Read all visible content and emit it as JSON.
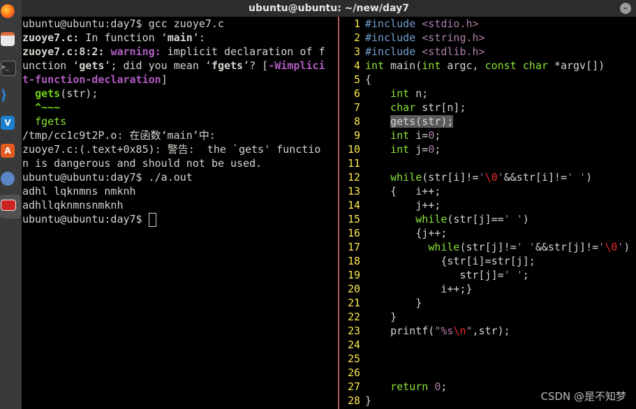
{
  "window": {
    "title": "ubuntu@ubuntu: ~/new/day7"
  },
  "dock": {
    "icons": [
      "firefox-icon",
      "files-icon",
      "terminal-icon",
      "vscode-icon",
      "vlc-icon",
      "software-center-icon",
      "network-icon",
      "active-app-icon"
    ]
  },
  "terminal": {
    "lines": [
      [
        {
          "t": "ubuntu@ubuntu:day7$ gcc zuoye7.c",
          "c": ""
        }
      ],
      [
        {
          "t": "zuoye7.c:",
          "c": "b"
        },
        {
          "t": " In function ‘",
          "c": ""
        },
        {
          "t": "main",
          "c": "b"
        },
        {
          "t": "’:",
          "c": ""
        }
      ],
      [
        {
          "t": "zuoye7.c:8:2: ",
          "c": "b"
        },
        {
          "t": "warning: ",
          "c": "mag"
        },
        {
          "t": "implicit declaration of f",
          "c": ""
        }
      ],
      [
        {
          "t": "unction ‘",
          "c": ""
        },
        {
          "t": "gets",
          "c": "b"
        },
        {
          "t": "’; did you mean ‘",
          "c": ""
        },
        {
          "t": "fgets",
          "c": "b"
        },
        {
          "t": "’? [",
          "c": ""
        },
        {
          "t": "-Wimplici",
          "c": "mag"
        }
      ],
      [
        {
          "t": "t-function-declaration",
          "c": "mag"
        },
        {
          "t": "]",
          "c": ""
        }
      ],
      [
        {
          "t": "  ",
          "c": ""
        },
        {
          "t": "gets",
          "c": "grn2"
        },
        {
          "t": "(str);",
          "c": ""
        }
      ],
      [
        {
          "t": "  ",
          "c": ""
        },
        {
          "t": "^~~~",
          "c": "grn2"
        }
      ],
      [
        {
          "t": "  ",
          "c": ""
        },
        {
          "t": "fgets",
          "c": "grn"
        }
      ],
      [
        {
          "t": "/tmp/cc1c9t2P.o: 在函数‘main’中:",
          "c": ""
        }
      ],
      [
        {
          "t": "zuoye7.c:(.text+0x85): 警告:  the `gets' functio",
          "c": ""
        }
      ],
      [
        {
          "t": "n is dangerous and should not be used.",
          "c": ""
        }
      ],
      [
        {
          "t": "ubuntu@ubuntu:day7$ ./a.out",
          "c": ""
        }
      ],
      [
        {
          "t": "adhl lqknmns nmknh",
          "c": ""
        }
      ],
      [
        {
          "t": "adhllqknmnsnmknh",
          "c": ""
        }
      ],
      [
        {
          "t": "ubuntu@ubuntu:day7$ ",
          "c": ""
        }
      ]
    ]
  },
  "editor": {
    "lines": [
      {
        "n": "1",
        "s": [
          {
            "t": "#include ",
            "c": "pp"
          },
          {
            "t": "<stdio.h>",
            "c": "str"
          }
        ]
      },
      {
        "n": "2",
        "s": [
          {
            "t": "#include ",
            "c": "pp"
          },
          {
            "t": "<string.h>",
            "c": "str"
          }
        ]
      },
      {
        "n": "3",
        "s": [
          {
            "t": "#include ",
            "c": "pp"
          },
          {
            "t": "<stdlib.h>",
            "c": "str"
          }
        ]
      },
      {
        "n": "4",
        "s": [
          {
            "t": "int",
            "c": "kw"
          },
          {
            "t": " main(",
            "c": ""
          },
          {
            "t": "int",
            "c": "kw"
          },
          {
            "t": " argc, ",
            "c": ""
          },
          {
            "t": "const",
            "c": "kw"
          },
          {
            "t": " ",
            "c": ""
          },
          {
            "t": "char",
            "c": "kw"
          },
          {
            "t": " *argv[])",
            "c": ""
          }
        ]
      },
      {
        "n": "5",
        "s": [
          {
            "t": "{",
            "c": ""
          }
        ]
      },
      {
        "n": "6",
        "s": [
          {
            "t": "    ",
            "c": ""
          },
          {
            "t": "int",
            "c": "kw"
          },
          {
            "t": " n;",
            "c": ""
          }
        ]
      },
      {
        "n": "7",
        "s": [
          {
            "t": "    ",
            "c": ""
          },
          {
            "t": "char",
            "c": "kw"
          },
          {
            "t": " str[n];",
            "c": ""
          }
        ]
      },
      {
        "n": "8",
        "s": [
          {
            "t": "    ",
            "c": ""
          },
          {
            "t": "gets(str);",
            "c": "hl"
          }
        ]
      },
      {
        "n": "9",
        "s": [
          {
            "t": "    ",
            "c": ""
          },
          {
            "t": "int",
            "c": "kw"
          },
          {
            "t": " i=",
            "c": ""
          },
          {
            "t": "0",
            "c": "str"
          },
          {
            "t": ";",
            "c": ""
          }
        ]
      },
      {
        "n": "10",
        "s": [
          {
            "t": "    ",
            "c": ""
          },
          {
            "t": "int",
            "c": "kw"
          },
          {
            "t": " j=",
            "c": ""
          },
          {
            "t": "0",
            "c": "str"
          },
          {
            "t": ";",
            "c": ""
          }
        ]
      },
      {
        "n": "11",
        "s": []
      },
      {
        "n": "12",
        "s": [
          {
            "t": "    ",
            "c": ""
          },
          {
            "t": "while",
            "c": "kw"
          },
          {
            "t": "(str[i]!=",
            "c": ""
          },
          {
            "t": "'",
            "c": "str"
          },
          {
            "t": "\\0",
            "c": "spec"
          },
          {
            "t": "'",
            "c": "str"
          },
          {
            "t": "&&str[i]!=",
            "c": ""
          },
          {
            "t": "' '",
            "c": "str"
          },
          {
            "t": ")",
            "c": ""
          }
        ]
      },
      {
        "n": "13",
        "s": [
          {
            "t": "    {   i++;",
            "c": ""
          }
        ]
      },
      {
        "n": "14",
        "s": [
          {
            "t": "        j++;",
            "c": ""
          }
        ]
      },
      {
        "n": "15",
        "s": [
          {
            "t": "        ",
            "c": ""
          },
          {
            "t": "while",
            "c": "kw"
          },
          {
            "t": "(str[j]==",
            "c": ""
          },
          {
            "t": "' '",
            "c": "str"
          },
          {
            "t": ")",
            "c": ""
          }
        ]
      },
      {
        "n": "16",
        "s": [
          {
            "t": "        {j++;",
            "c": ""
          }
        ]
      },
      {
        "n": "17",
        "s": [
          {
            "t": "          ",
            "c": ""
          },
          {
            "t": "while",
            "c": "kw"
          },
          {
            "t": "(str[j]!=",
            "c": ""
          },
          {
            "t": "' '",
            "c": "str"
          },
          {
            "t": "&&str[j]!=",
            "c": ""
          },
          {
            "t": "'",
            "c": "str"
          },
          {
            "t": "\\0",
            "c": "spec"
          },
          {
            "t": "'",
            "c": "str"
          },
          {
            "t": ")",
            "c": ""
          }
        ]
      },
      {
        "n": "18",
        "s": [
          {
            "t": "            {str[i]=str[j];",
            "c": ""
          }
        ]
      },
      {
        "n": "19",
        "s": [
          {
            "t": "               str[j]=",
            "c": ""
          },
          {
            "t": "' '",
            "c": "str"
          },
          {
            "t": ";",
            "c": ""
          }
        ]
      },
      {
        "n": "20",
        "s": [
          {
            "t": "            i++;}",
            "c": ""
          }
        ]
      },
      {
        "n": "21",
        "s": [
          {
            "t": "        }",
            "c": ""
          }
        ]
      },
      {
        "n": "22",
        "s": [
          {
            "t": "    }",
            "c": ""
          }
        ]
      },
      {
        "n": "23",
        "s": [
          {
            "t": "    printf(",
            "c": ""
          },
          {
            "t": "\"%s",
            "c": "str"
          },
          {
            "t": "\\n",
            "c": "spec"
          },
          {
            "t": "\"",
            "c": "str"
          },
          {
            "t": ",str);",
            "c": ""
          }
        ]
      },
      {
        "n": "24",
        "s": []
      },
      {
        "n": "25",
        "s": []
      },
      {
        "n": "26",
        "s": []
      },
      {
        "n": "27",
        "s": [
          {
            "t": "    ",
            "c": ""
          },
          {
            "t": "return",
            "c": "kw"
          },
          {
            "t": " ",
            "c": ""
          },
          {
            "t": "0",
            "c": "str"
          },
          {
            "t": ";",
            "c": ""
          }
        ]
      },
      {
        "n": "28",
        "s": [
          {
            "t": "}",
            "c": ""
          }
        ]
      }
    ]
  },
  "watermark": "CSDN @是不知梦",
  "colors": {
    "terminal_bg": "#000000",
    "titlebar_bg": "#2c2c2c",
    "line_number": "#fce94f",
    "keyword": "#8ae234",
    "preprocessor": "#729fcf",
    "string": "#ad7fa8"
  }
}
